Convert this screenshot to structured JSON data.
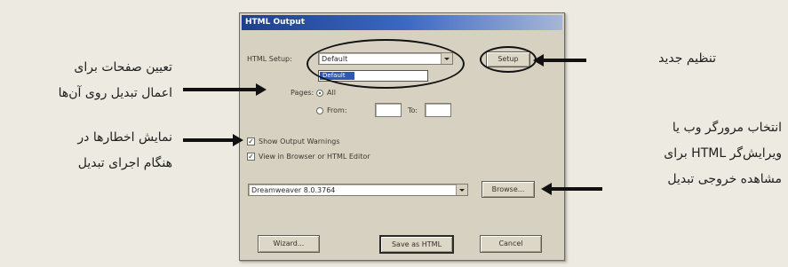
{
  "dialog": {
    "title": "HTML Output",
    "setup_label": "HTML Setup:",
    "setup_value": "Default",
    "setup_option": "Default",
    "setup_button": "Setup",
    "pages_label": "Pages:",
    "all_label": "All",
    "from_label": "From:",
    "to_label": "To:",
    "show_warnings_label": "Show Output Warnings",
    "view_in_browser_label": "View in Browser or HTML Editor",
    "browser_value": "Dreamweaver 8.0.3764",
    "browse_button": "Browse...",
    "wizard_button": "Wizard...",
    "save_button": "Save as HTML",
    "cancel_button": "Cancel"
  },
  "annotations": {
    "setup_note": "تنظیم جدید",
    "pages_note_line1": "تعیین صفحات برای",
    "pages_note_line2": "اعمال تبدیل روی آن‌ها",
    "warnings_note_line1": "نمایش اخطارها در",
    "warnings_note_line2": "هنگام اجرای تبدیل",
    "browser_note_line1": "انتخاب مرورگر وب یا",
    "browser_note_line2": "ویرایش‌گر HTML برای",
    "browser_note_line3": "مشاهده خروجی تبدیل"
  }
}
